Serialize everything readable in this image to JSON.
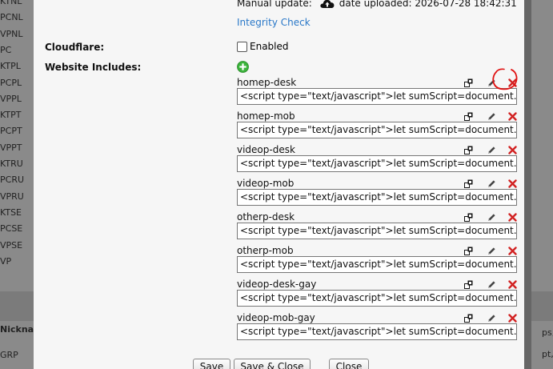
{
  "background": {
    "left_codes": [
      "KTNL",
      "PCNL",
      "VPNL",
      "PC",
      "KTPL",
      "PCPL",
      "VPPL",
      "KTPT",
      "PCPT",
      "VPPT",
      "KTRU",
      "PCRU",
      "VPRU",
      "KTSE",
      "PCSE",
      "VPSE",
      "VP"
    ],
    "nickname_heading": "Nicknar",
    "group_snip": "GRP",
    "right_snips": [
      "ps,",
      "pt,"
    ]
  },
  "form": {
    "manual_update_label": "Manual update:",
    "date_uploaded": "date uploaded: 2026-07-28 18:42:31",
    "integrity_link": "Integrity Check",
    "cloudflare_label": "Cloudflare:",
    "cloudflare_checkbox_label": "Enabled",
    "cloudflare_enabled": false,
    "website_includes_label": "Website Includes:",
    "includes": [
      {
        "name": "homep-desk",
        "code": "<script type=\"text/javascript\">let sumScript=document.cre"
      },
      {
        "name": "homep-mob",
        "code": "<script type=\"text/javascript\">let sumScript=document.cre"
      },
      {
        "name": "videop-desk",
        "code": "<script type=\"text/javascript\">let sumScript=document.cre"
      },
      {
        "name": "videop-mob",
        "code": "<script type=\"text/javascript\">let sumScript=document.cre"
      },
      {
        "name": "otherp-desk",
        "code": "<script type=\"text/javascript\">let sumScript=document.cre"
      },
      {
        "name": "otherp-mob",
        "code": "<script type=\"text/javascript\">let sumScript=document.cre"
      },
      {
        "name": "videop-desk-gay",
        "code": "<script type=\"text/javascript\">let sumScript=document.cre"
      },
      {
        "name": "videop-mob-gay",
        "code": "<script type=\"text/javascript\">let sumScript=document.cre"
      }
    ]
  },
  "buttons": {
    "save": "Save",
    "save_close": "Save & Close",
    "close": "Close"
  },
  "colors": {
    "link": "#2a78c8",
    "delete": "#d22222",
    "add": "#3bb33b",
    "annotation": "#e01010"
  }
}
